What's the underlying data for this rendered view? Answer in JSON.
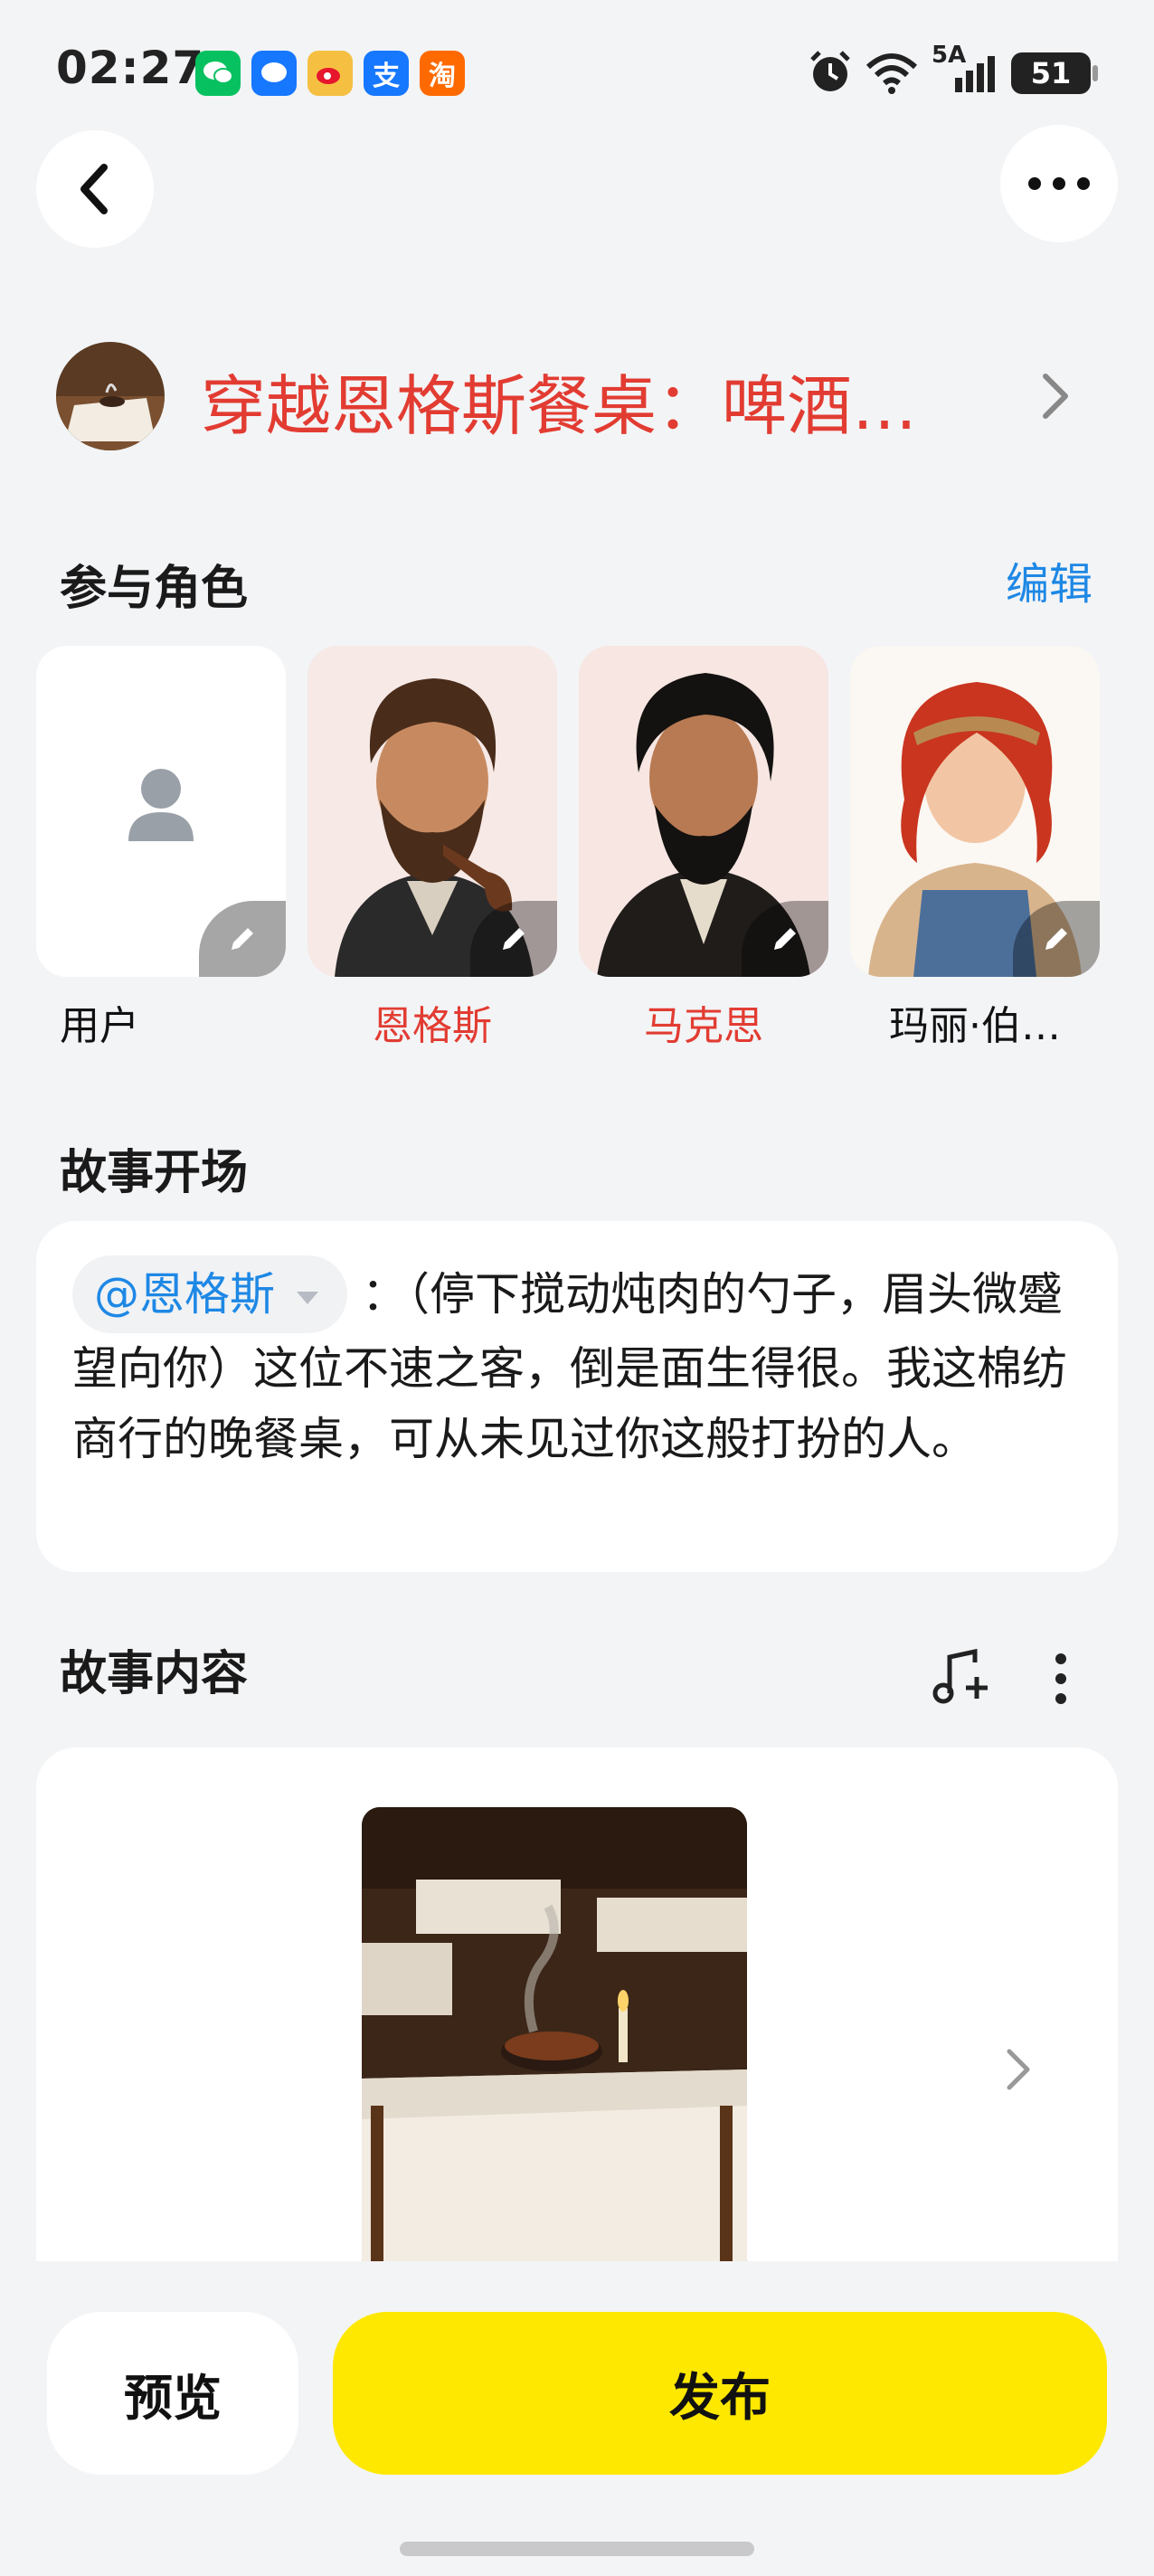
{
  "status_bar": {
    "time": "02:27",
    "app_icons": [
      {
        "name": "wechat-icon",
        "color": "#07c160",
        "glyph": "✉"
      },
      {
        "name": "messages-icon",
        "color": "#1677ff",
        "glyph": "●"
      },
      {
        "name": "weibo-icon",
        "color": "#f5c042",
        "glyph": "◉"
      },
      {
        "name": "alipay-icon",
        "color": "#1677ff",
        "glyph": "支"
      },
      {
        "name": "taobao-icon",
        "color": "#ff6a00",
        "glyph": "淘"
      }
    ],
    "network": "5A",
    "battery": "51"
  },
  "header": {
    "back_icon": "chevron-left-icon",
    "more_icon": "more-horizontal-icon"
  },
  "story": {
    "title": "穿越恩格斯餐桌：啤酒…"
  },
  "roles": {
    "heading": "参与角色",
    "edit_label": "编辑",
    "items": [
      {
        "name": "用户",
        "color": "#1a1a1a"
      },
      {
        "name": "恩格斯",
        "color": "#e23c32"
      },
      {
        "name": "马克思",
        "color": "#e23c32"
      },
      {
        "name": "玛丽·伯…",
        "color": "#1a1a1a"
      }
    ]
  },
  "opening": {
    "heading": "故事开场",
    "mention": "@恩格斯",
    "text": "：（停下搅动炖肉的勺子，眉头微蹙望向你）这位不速之客，倒是面生得很。我这棉纺商行的晚餐桌，可从未见过你这般打扮的人。"
  },
  "content": {
    "heading": "故事内容"
  },
  "actions": {
    "preview_label": "预览",
    "publish_label": "发布"
  },
  "colors": {
    "accent_red": "#e23c32",
    "link_blue": "#1e88e5",
    "publish_yellow": "#ffe800"
  }
}
